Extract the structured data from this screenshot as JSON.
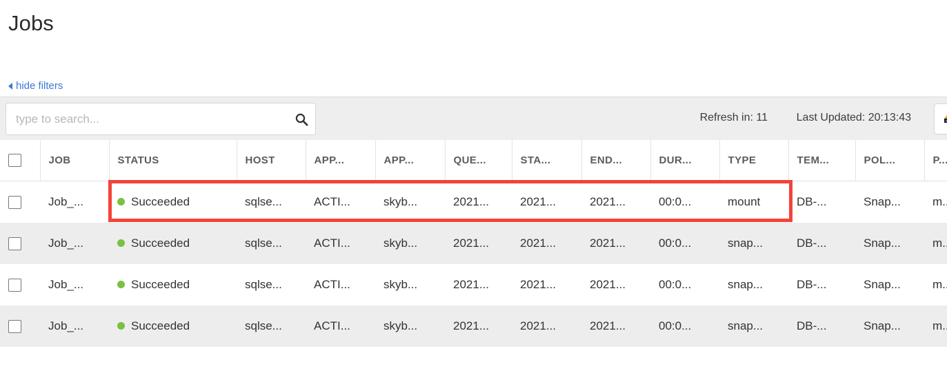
{
  "page": {
    "title": "Jobs"
  },
  "filters": {
    "toggle_label": "hide filters",
    "toggle_icon": "triangle-left-icon"
  },
  "toolbar": {
    "search": {
      "placeholder": "type to search...",
      "value": "",
      "icon": "search-icon"
    },
    "refresh_in": "Refresh in: 11",
    "last_updated": "Last Updated: 20:13:43",
    "export_button": {
      "icon": "export-icon",
      "label": ""
    }
  },
  "table": {
    "columns": [
      {
        "label": "",
        "name": "select-all"
      },
      {
        "label": "JOB",
        "name": "job"
      },
      {
        "label": "STATUS",
        "name": "status"
      },
      {
        "label": "HOST",
        "name": "host"
      },
      {
        "label": "APP...",
        "name": "app-type"
      },
      {
        "label": "APP...",
        "name": "app-name"
      },
      {
        "label": "QUE...",
        "name": "queued-time"
      },
      {
        "label": "STA...",
        "name": "start-time"
      },
      {
        "label": "END...",
        "name": "end-time"
      },
      {
        "label": "DUR...",
        "name": "duration"
      },
      {
        "label": "TYPE",
        "name": "type"
      },
      {
        "label": "TEM...",
        "name": "template"
      },
      {
        "label": "POL...",
        "name": "policy"
      },
      {
        "label": "P...",
        "name": "partial"
      }
    ],
    "rows": [
      {
        "job": "Job_...",
        "status": "Succeeded",
        "status_color": "#7ac143",
        "host": "sqlse...",
        "app_type": "ACTI...",
        "app_name": "skyb...",
        "queued": "2021...",
        "start": "2021...",
        "end": "2021...",
        "duration": "00:0...",
        "type": "mount",
        "template": "DB-...",
        "policy": "Snap...",
        "partial": "m..."
      },
      {
        "job": "Job_...",
        "status": "Succeeded",
        "status_color": "#7ac143",
        "host": "sqlse...",
        "app_type": "ACTI...",
        "app_name": "skyb...",
        "queued": "2021...",
        "start": "2021...",
        "end": "2021...",
        "duration": "00:0...",
        "type": "snap...",
        "template": "DB-...",
        "policy": "Snap...",
        "partial": "m..."
      },
      {
        "job": "Job_...",
        "status": "Succeeded",
        "status_color": "#7ac143",
        "host": "sqlse...",
        "app_type": "ACTI...",
        "app_name": "skyb...",
        "queued": "2021...",
        "start": "2021...",
        "end": "2021...",
        "duration": "00:0...",
        "type": "snap...",
        "template": "DB-...",
        "policy": "Snap...",
        "partial": "m..."
      },
      {
        "job": "Job_...",
        "status": "Succeeded",
        "status_color": "#7ac143",
        "host": "sqlse...",
        "app_type": "ACTI...",
        "app_name": "skyb...",
        "queued": "2021...",
        "start": "2021...",
        "end": "2021...",
        "duration": "00:0...",
        "type": "snap...",
        "template": "DB-...",
        "policy": "Snap...",
        "partial": "m..."
      }
    ]
  },
  "annotation": {
    "color": "#f4433c",
    "label": ""
  },
  "colors": {
    "link": "#3c78d8",
    "status_success": "#7ac143",
    "toolbar_bg": "#eeeeee",
    "row_stripe": "#ededed",
    "header_text": "#5c5c5c",
    "annotation": "#f4433c"
  }
}
